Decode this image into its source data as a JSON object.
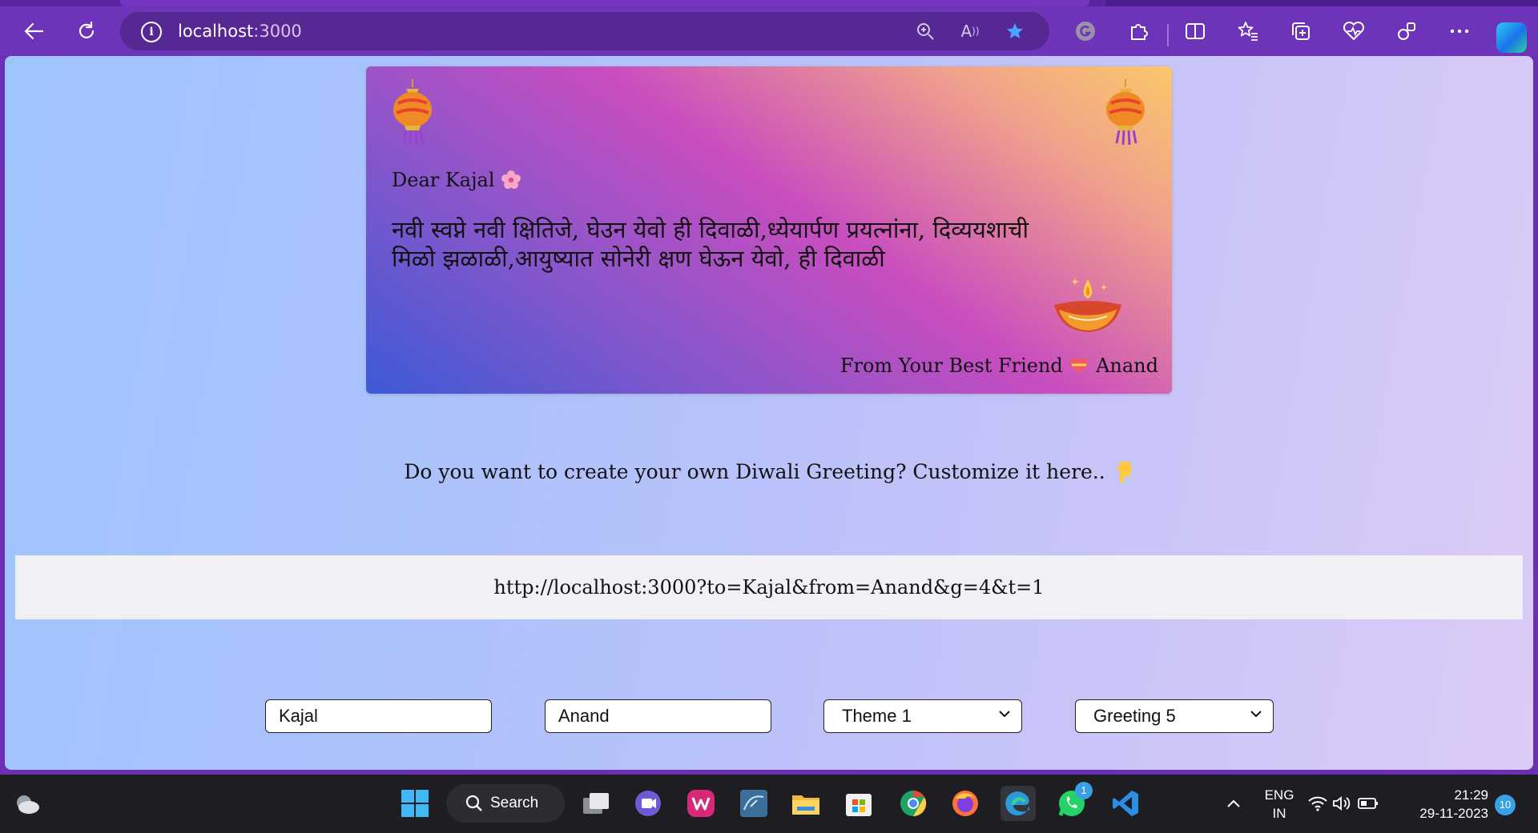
{
  "browser": {
    "url_host": "localhost",
    "url_port": ":3000"
  },
  "card": {
    "greeting_line": "Dear Kajal",
    "message": "नवी स्वप्ने नवी क्षितिजे, घेउन येवो ही दिवाळी,ध्येयार्पण प्रयत्नांना, दिव्ययशाची मिळो झळाळी,आयुष्यात सोनेरी क्षण घेऊन येवो, ही दिवाळी",
    "from_prefix": "From Your Best Friend",
    "from_name": "Anand"
  },
  "prompt": {
    "text": "Do you want to create your own Diwali Greeting? Customize it here.."
  },
  "share_link": "http://localhost:3000?to=Kajal&from=Anand&g=4&t=1",
  "form": {
    "to_value": "Kajal",
    "from_value": "Anand",
    "theme_selected": "Theme 1",
    "greeting_selected": "Greeting 5"
  },
  "taskbar": {
    "search_label": "Search",
    "whatsapp_badge": "1",
    "lang_line1": "ENG",
    "lang_line2": "IN",
    "time": "21:29",
    "date": "29-11-2023",
    "notification_count": "10"
  },
  "colors": {
    "chrome": "#6d33b8",
    "card_gradient_start": "#3c5ad5",
    "card_gradient_mid": "#c94dbf",
    "card_gradient_end": "#fbc76a"
  }
}
